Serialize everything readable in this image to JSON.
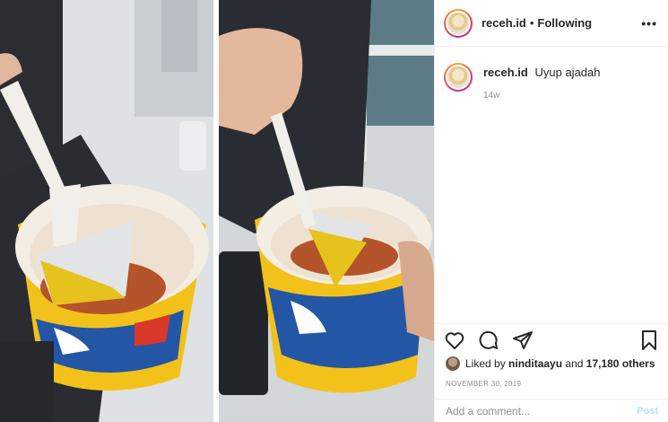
{
  "post": {
    "username": "receh.id",
    "separator": "•",
    "follow_status": "Following",
    "more_label": "•••",
    "caption_username": "receh.id",
    "caption_text": "Uyup ajadah",
    "caption_time": "14w",
    "liked_by_prefix": "Liked by",
    "liked_by_user": "ninditaayu",
    "liked_by_middle": "and",
    "liked_by_others": "17,180 others",
    "date": "NOVEMBER 30, 2019",
    "comment_placeholder": "Add a comment...",
    "post_label": "Post"
  },
  "icons": {
    "like": "heart-icon",
    "comment": "comment-icon",
    "share": "paper-plane-icon",
    "save": "bookmark-icon"
  },
  "colors": {
    "text": "#262626",
    "muted": "#8e8e8e",
    "post_button": "#b2dffc",
    "cup_yellow": "#f2c21a",
    "cup_blue": "#2456a6",
    "sauce": "#b5532a"
  }
}
